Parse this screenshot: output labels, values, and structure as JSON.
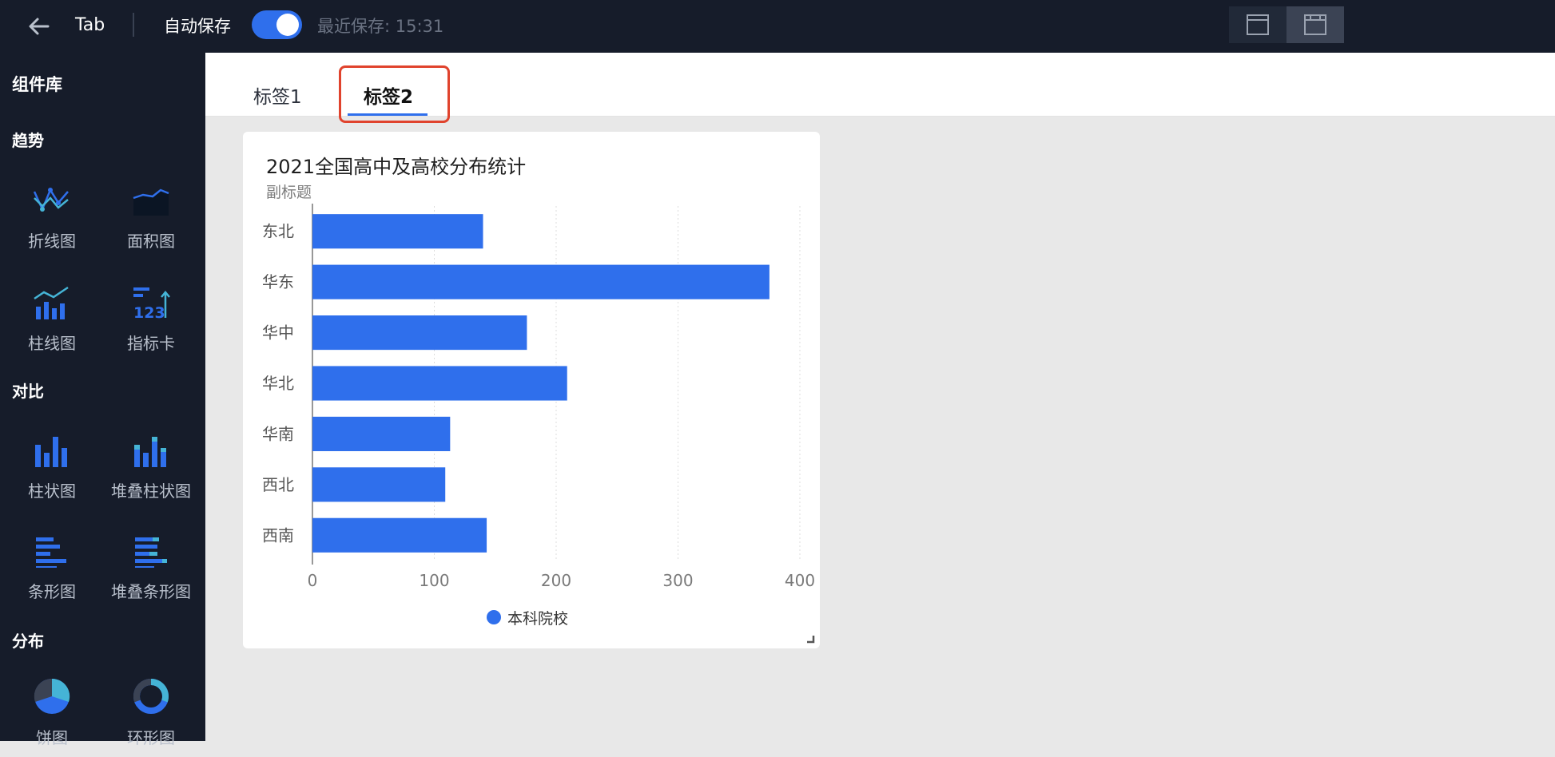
{
  "topbar": {
    "tab_title": "Tab",
    "autosave_label": "自动保存",
    "autosave_enabled": true,
    "last_saved": "最近保存: 15:31"
  },
  "sidebar": {
    "title": "组件库",
    "sections": [
      {
        "label": "趋势",
        "items": [
          {
            "label": "折线图",
            "icon": "line-chart-icon"
          },
          {
            "label": "面积图",
            "icon": "area-chart-icon"
          },
          {
            "label": "柱线图",
            "icon": "bar-line-chart-icon"
          },
          {
            "label": "指标卡",
            "icon": "kpi-card-icon"
          }
        ]
      },
      {
        "label": "对比",
        "items": [
          {
            "label": "柱状图",
            "icon": "column-chart-icon"
          },
          {
            "label": "堆叠柱状图",
            "icon": "stacked-column-chart-icon"
          },
          {
            "label": "条形图",
            "icon": "bar-chart-icon"
          },
          {
            "label": "堆叠条形图",
            "icon": "stacked-bar-chart-icon"
          }
        ]
      },
      {
        "label": "分布",
        "items": [
          {
            "label": "饼图",
            "icon": "pie-chart-icon"
          },
          {
            "label": "环形图",
            "icon": "donut-chart-icon"
          }
        ]
      }
    ]
  },
  "tabs": [
    {
      "label": "标签1",
      "active": false
    },
    {
      "label": "标签2",
      "active": true
    }
  ],
  "colors": {
    "accent": "#2f6fec",
    "highlight": "#e0432d",
    "sidebar_bg": "#161c2a"
  },
  "chart_data": {
    "type": "bar",
    "orientation": "horizontal",
    "title": "2021全国高中及高校分布统计",
    "subtitle": "副标题",
    "categories": [
      "东北",
      "华东",
      "华中",
      "华北",
      "华南",
      "西北",
      "西南"
    ],
    "series": [
      {
        "name": "本科院校",
        "color": "#2f6fec",
        "values": [
          140,
          375,
          176,
          209,
          113,
          109,
          143
        ]
      }
    ],
    "xlim": [
      0,
      400
    ],
    "xticks": [
      0,
      100,
      200,
      300,
      400
    ],
    "grid": true,
    "legend_position": "bottom"
  }
}
